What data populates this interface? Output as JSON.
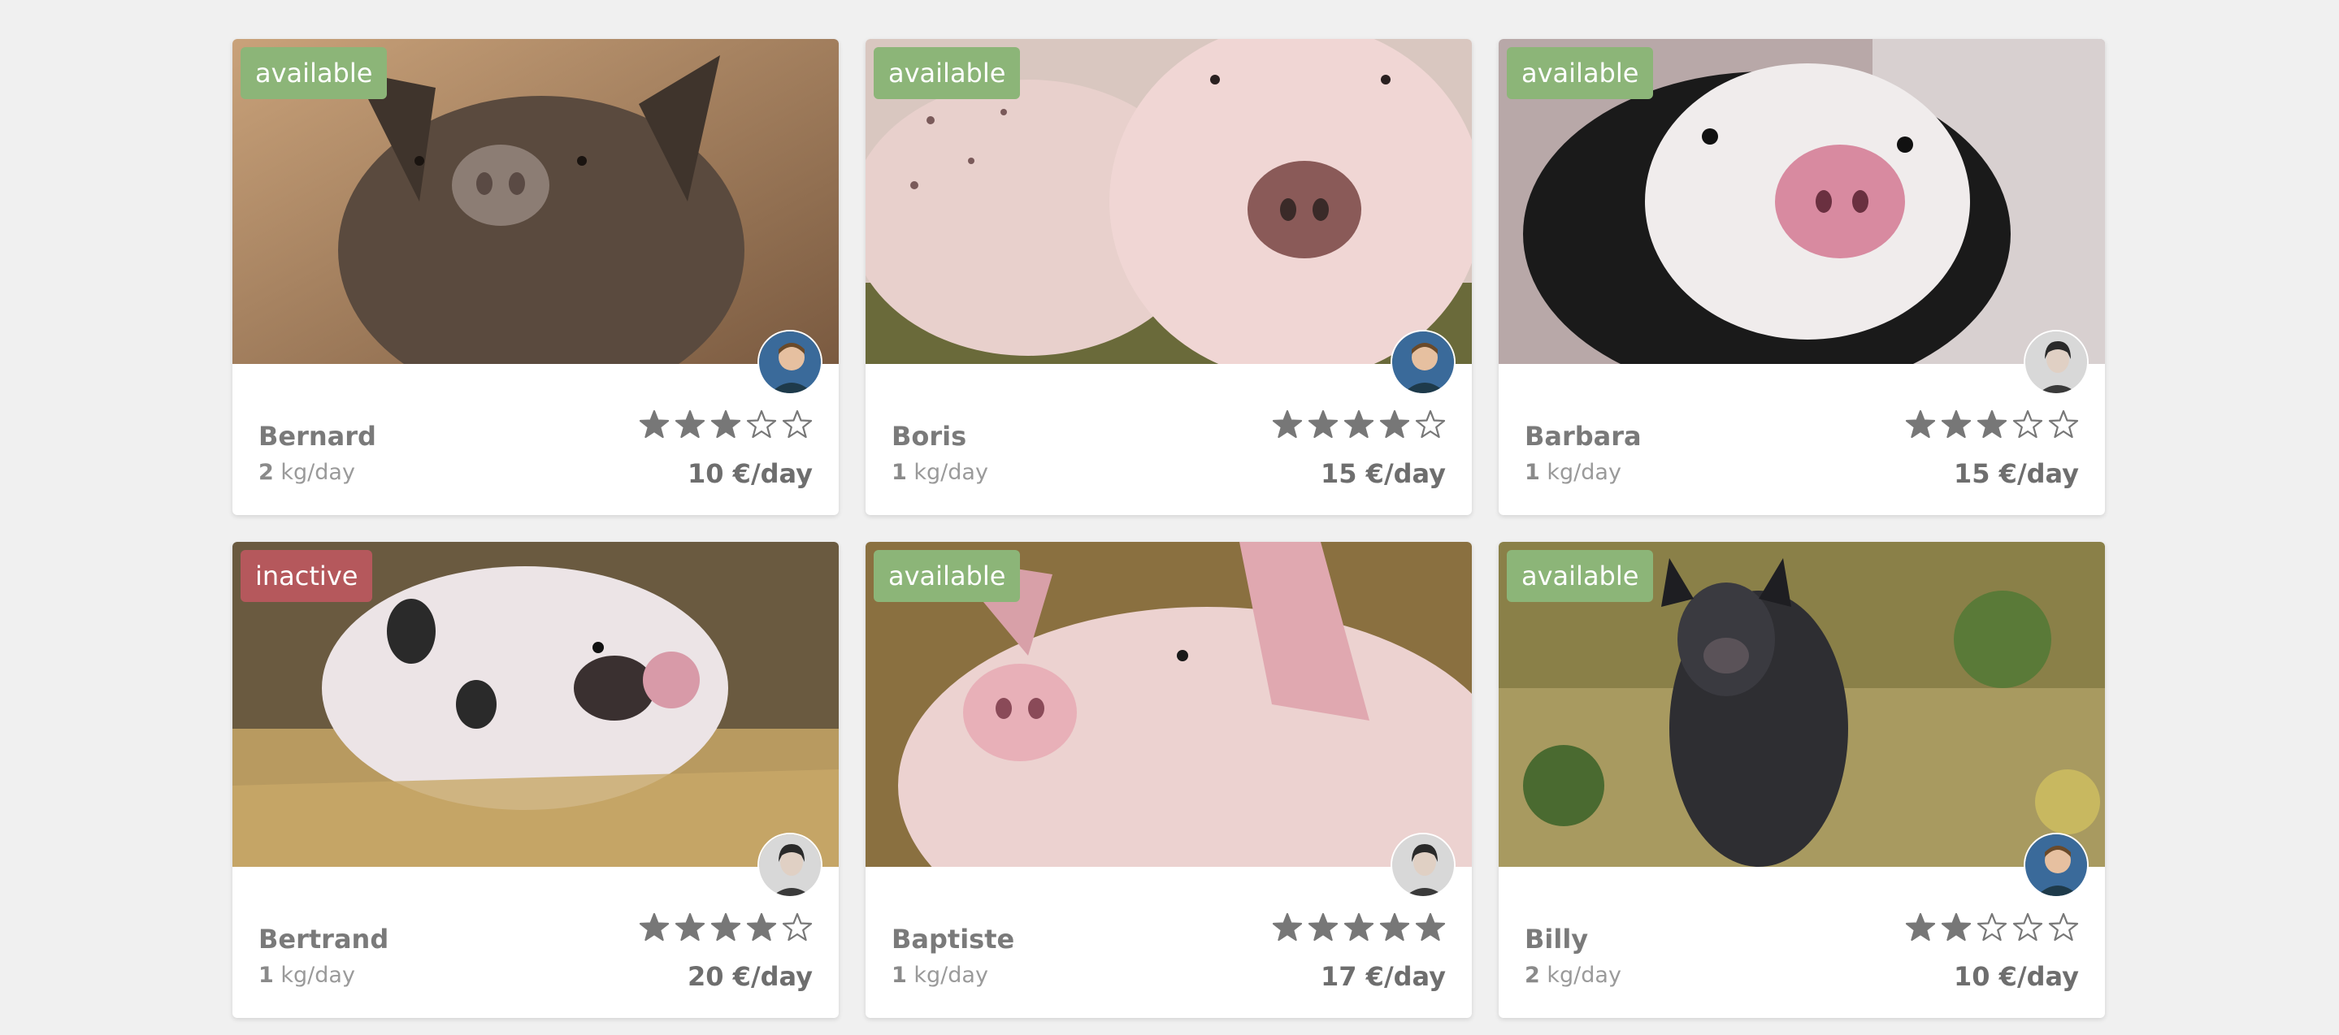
{
  "colors": {
    "available": "#8cb578",
    "inactive": "#b5585c",
    "star": "#777777",
    "text": "#7a7a7a"
  },
  "feed_unit": "kg/day",
  "pigs": [
    {
      "name": "Bernard",
      "status": "available",
      "feed": "2",
      "price": "10 €/day",
      "rating": 3,
      "owner_avatar": "avatar-man-icon",
      "photo": "brown-pig-photo"
    },
    {
      "name": "Boris",
      "status": "available",
      "feed": "1",
      "price": "15 €/day",
      "rating": 4,
      "owner_avatar": "avatar-man-icon",
      "photo": "spotted-pink-pig-photo"
    },
    {
      "name": "Barbara",
      "status": "available",
      "feed": "1",
      "price": "15 €/day",
      "rating": 3,
      "owner_avatar": "avatar-woman-icon",
      "photo": "black-white-piglet-photo"
    },
    {
      "name": "Bertrand",
      "status": "inactive",
      "feed": "1",
      "price": "20 €/day",
      "rating": 4,
      "owner_avatar": "avatar-woman-icon",
      "photo": "spotted-piglet-straw-photo"
    },
    {
      "name": "Baptiste",
      "status": "available",
      "feed": "1",
      "price": "17 €/day",
      "rating": 5,
      "owner_avatar": "avatar-woman-icon",
      "photo": "pink-pig-straw-photo"
    },
    {
      "name": "Billy",
      "status": "available",
      "feed": "2",
      "price": "10 €/day",
      "rating": 2,
      "owner_avatar": "avatar-man-icon",
      "photo": "black-pig-forest-photo"
    }
  ]
}
